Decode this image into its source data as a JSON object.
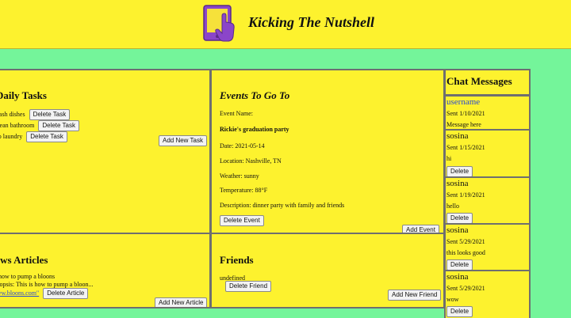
{
  "header": {
    "title": "Kicking The Nutshell"
  },
  "tasks": {
    "title": "Daily Tasks",
    "items": [
      {
        "label": "Wash dishes"
      },
      {
        "label": "Clean bathroom"
      },
      {
        "label": "Do laundry"
      }
    ],
    "delete_label": "Delete Task",
    "add_label": "Add New Task"
  },
  "events": {
    "title": "Events To Go To",
    "name_label": "Event Name:",
    "name_value": "Rickie's graduation party",
    "date": "Date: 2021-05-14",
    "location": "Location: Nashville, TN",
    "weather": "Weather: sunny",
    "temperature": "Temperature: 88°F",
    "description": "Description: dinner party with family and friends",
    "delete_label": "Delete Event",
    "add_label": "Add Event"
  },
  "articles": {
    "title": "News Articles",
    "line1": "how to pump a bloons",
    "line2": "Synopsis: This is how to pump a bloon...",
    "link": "www.bloons.com\"",
    "delete_label": "Delete Article",
    "add_label": "Add New Article"
  },
  "friends": {
    "title": "Friends",
    "entry": "undefined",
    "delete_label": "Delete Friend",
    "add_label": "Add New Friend"
  },
  "chat": {
    "title": "Chat Messages",
    "delete_label": "Delete",
    "messages": [
      {
        "user": "username",
        "sent": "Sent 1/10/2021",
        "text": "Message here"
      },
      {
        "user": "sosina",
        "sent": "Sent 1/15/2021",
        "text": "hi"
      },
      {
        "user": "sosina",
        "sent": "Sent 1/19/2021",
        "text": "hello"
      },
      {
        "user": "sosina",
        "sent": "Sent 5/29/2021",
        "text": "this looks good"
      },
      {
        "user": "sosina",
        "sent": "Sent 5/29/2021",
        "text": "wow"
      }
    ]
  }
}
